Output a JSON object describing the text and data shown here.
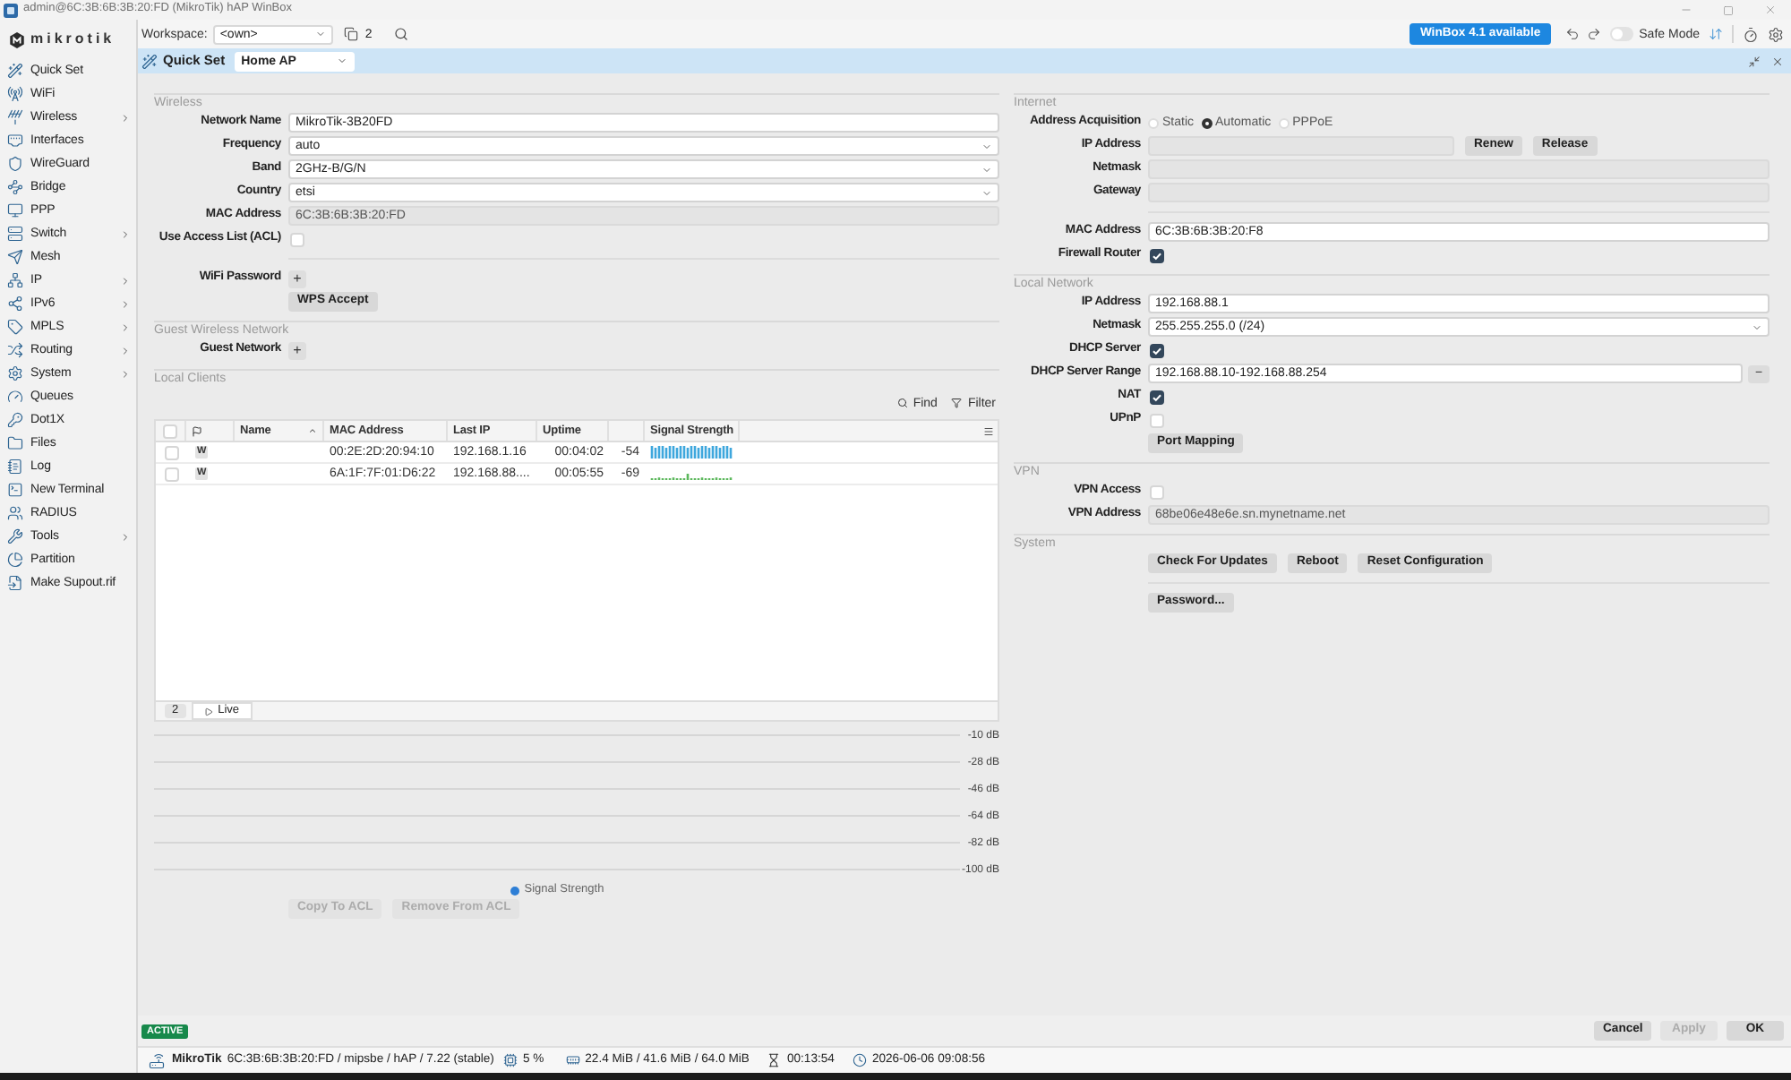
{
  "window": {
    "title": "admin@6C:3B:6B:3B:20:FD (MikroTik) hAP WinBox"
  },
  "sidebar": {
    "logo": "mikrotik",
    "items": [
      {
        "label": "Quick Set",
        "submenu": false
      },
      {
        "label": "WiFi",
        "submenu": false
      },
      {
        "label": "Wireless",
        "submenu": true
      },
      {
        "label": "Interfaces",
        "submenu": false
      },
      {
        "label": "WireGuard",
        "submenu": false
      },
      {
        "label": "Bridge",
        "submenu": false
      },
      {
        "label": "PPP",
        "submenu": false
      },
      {
        "label": "Switch",
        "submenu": true
      },
      {
        "label": "Mesh",
        "submenu": false
      },
      {
        "label": "IP",
        "submenu": true
      },
      {
        "label": "IPv6",
        "submenu": true
      },
      {
        "label": "MPLS",
        "submenu": true
      },
      {
        "label": "Routing",
        "submenu": true
      },
      {
        "label": "System",
        "submenu": true
      },
      {
        "label": "Queues",
        "submenu": false
      },
      {
        "label": "Dot1X",
        "submenu": false
      },
      {
        "label": "Files",
        "submenu": false
      },
      {
        "label": "Log",
        "submenu": false
      },
      {
        "label": "New Terminal",
        "submenu": false
      },
      {
        "label": "RADIUS",
        "submenu": false
      },
      {
        "label": "Tools",
        "submenu": true
      },
      {
        "label": "Partition",
        "submenu": false
      },
      {
        "label": "Make Supout.rif",
        "submenu": false
      }
    ]
  },
  "toolbar": {
    "workspace_label": "Workspace:",
    "workspace": "<own>",
    "window_count": "2",
    "update_button": "WinBox 4.1 available",
    "safe_mode": {
      "label": "Safe Mode",
      "on": false
    }
  },
  "quick_set": {
    "title": "Quick Set",
    "mode": "Home AP"
  },
  "left_sections": [
    {
      "title": "Wireless",
      "groups": [
        [
          {
            "kind": "input",
            "label": "Network Name",
            "value": "MikroTik-3B20FD"
          },
          {
            "kind": "select",
            "label": "Frequency",
            "value": "auto"
          },
          {
            "kind": "select",
            "label": "Band",
            "value": "2GHz-B/G/N"
          },
          {
            "kind": "select",
            "label": "Country",
            "value": "etsi"
          },
          {
            "kind": "readonly",
            "label": "MAC Address",
            "value": "6C:3B:6B:3B:20:FD"
          },
          {
            "kind": "checkbox",
            "label": "Use Access List (ACL)",
            "checked": false
          }
        ],
        [
          {
            "kind": "add",
            "label": "WiFi Password",
            "action": "+"
          },
          {
            "kind": "buttons",
            "buttons": [
              {
                "label": "WPS Accept",
                "disabled": false
              }
            ]
          }
        ]
      ]
    },
    {
      "title": "Guest Wireless Network",
      "groups": [
        [
          {
            "kind": "add",
            "label": "Guest Network",
            "action": "+"
          }
        ]
      ]
    }
  ],
  "local_clients": {
    "title": "Local Clients",
    "find": "Find",
    "filter": "Filter",
    "header_checked": false,
    "columns": [
      {
        "label": "Name",
        "sorted": true
      },
      {
        "label": "MAC Address",
        "sorted": false
      },
      {
        "label": "Last IP",
        "sorted": false
      },
      {
        "label": "Uptime",
        "sorted": false
      },
      {
        "sorted": false
      },
      {
        "label": "Signal Strength",
        "sorted": false
      }
    ],
    "rows": [
      {
        "checked": false,
        "type": "W",
        "mac_address": "00:2E:2D:20:94:10",
        "last_ip": "192.168.1.16",
        "uptime": "00:04:02",
        "column_5": "-54",
        "kind": "strong",
        "color": "#3ea7dd"
      },
      {
        "checked": false,
        "type": "W",
        "mac_address": "6A:1F:7F:01:D6:22",
        "last_ip": "192.168.88....",
        "uptime": "00:05:55",
        "column_5": "-69",
        "kind": "weak",
        "color": "#5cb85c"
      }
    ],
    "count": "2",
    "live": "Live",
    "chart_data": {
      "type": "line",
      "ylim": [
        -100,
        -10
      ],
      "yticks": [
        {
          "value": -10,
          "label": "-10 dB"
        },
        {
          "value": -28,
          "label": "-28 dB"
        },
        {
          "value": -46,
          "label": "-46 dB"
        },
        {
          "value": -64,
          "label": "-64 dB"
        },
        {
          "value": -82,
          "label": "-82 dB"
        },
        {
          "value": -100,
          "label": "-100 dB"
        }
      ],
      "series": [
        {
          "name": "Signal Strength",
          "color": "#2e7fd6"
        }
      ]
    },
    "buttons": [
      {
        "label": "Copy To ACL",
        "disabled": true
      },
      {
        "label": "Remove From ACL",
        "disabled": true
      }
    ]
  },
  "right_sections": [
    {
      "title": "Internet",
      "groups": [
        [
          {
            "kind": "radio",
            "label": "Address Acquisition",
            "options": [
              {
                "label": "Static",
                "selected": false
              },
              {
                "label": "Automatic",
                "selected": true
              },
              {
                "label": "PPPoE",
                "selected": false
              }
            ]
          },
          {
            "kind": "readonly",
            "label": "IP Address",
            "buttons": [
              {
                "label": "Renew",
                "disabled": false
              },
              {
                "label": "Release",
                "disabled": false
              }
            ]
          },
          {
            "kind": "readonly",
            "label": "Netmask"
          },
          {
            "kind": "readonly",
            "label": "Gateway"
          }
        ],
        [
          {
            "kind": "input",
            "label": "MAC Address",
            "value": "6C:3B:6B:3B:20:F8"
          },
          {
            "kind": "checkbox",
            "label": "Firewall Router",
            "checked": true
          }
        ]
      ]
    },
    {
      "title": "Local Network",
      "groups": [
        [
          {
            "kind": "input",
            "label": "IP Address",
            "value": "192.168.88.1"
          },
          {
            "kind": "select",
            "label": "Netmask",
            "value": "255.255.255.0 (/24)"
          },
          {
            "kind": "checkbox",
            "label": "DHCP Server",
            "checked": true
          },
          {
            "kind": "input",
            "label": "DHCP Server Range",
            "value": "192.168.88.10-192.168.88.254",
            "action": "−"
          },
          {
            "kind": "checkbox",
            "label": "NAT",
            "checked": true
          },
          {
            "kind": "checkbox",
            "label": "UPnP",
            "checked": false
          },
          {
            "kind": "buttons",
            "buttons": [
              {
                "label": "Port Mapping",
                "disabled": false
              }
            ]
          }
        ]
      ]
    },
    {
      "title": "VPN",
      "groups": [
        [
          {
            "kind": "checkbox",
            "label": "VPN Access",
            "checked": false
          },
          {
            "kind": "readonly",
            "label": "VPN Address",
            "value": "68be06e48e6e.sn.mynetname.net"
          }
        ]
      ]
    },
    {
      "title": "System",
      "groups": [
        [
          {
            "kind": "buttons",
            "buttons": [
              {
                "label": "Check For Updates",
                "disabled": false
              },
              {
                "label": "Reboot",
                "disabled": false
              },
              {
                "label": "Reset Configuration",
                "disabled": false
              }
            ]
          }
        ],
        [
          {
            "kind": "buttons",
            "buttons": [
              {
                "label": "Password...",
                "disabled": false
              }
            ]
          }
        ]
      ]
    }
  ],
  "footer": {
    "badge": "ACTIVE",
    "buttons": [
      {
        "label": "Cancel",
        "disabled": false
      },
      {
        "label": "Apply",
        "disabled": true
      },
      {
        "label": "OK",
        "disabled": false
      }
    ]
  },
  "status_bar": {
    "device": "MikroTik",
    "details": "6C:3B:6B:3B:20:FD / mipsbe / hAP / 7.22 (stable)",
    "cpu": "5 %",
    "memory": "22.4 MiB / 41.6 MiB / 64.0 MiB",
    "uptime": "00:13:54",
    "clock": "2026-06-06 09:08:56"
  }
}
